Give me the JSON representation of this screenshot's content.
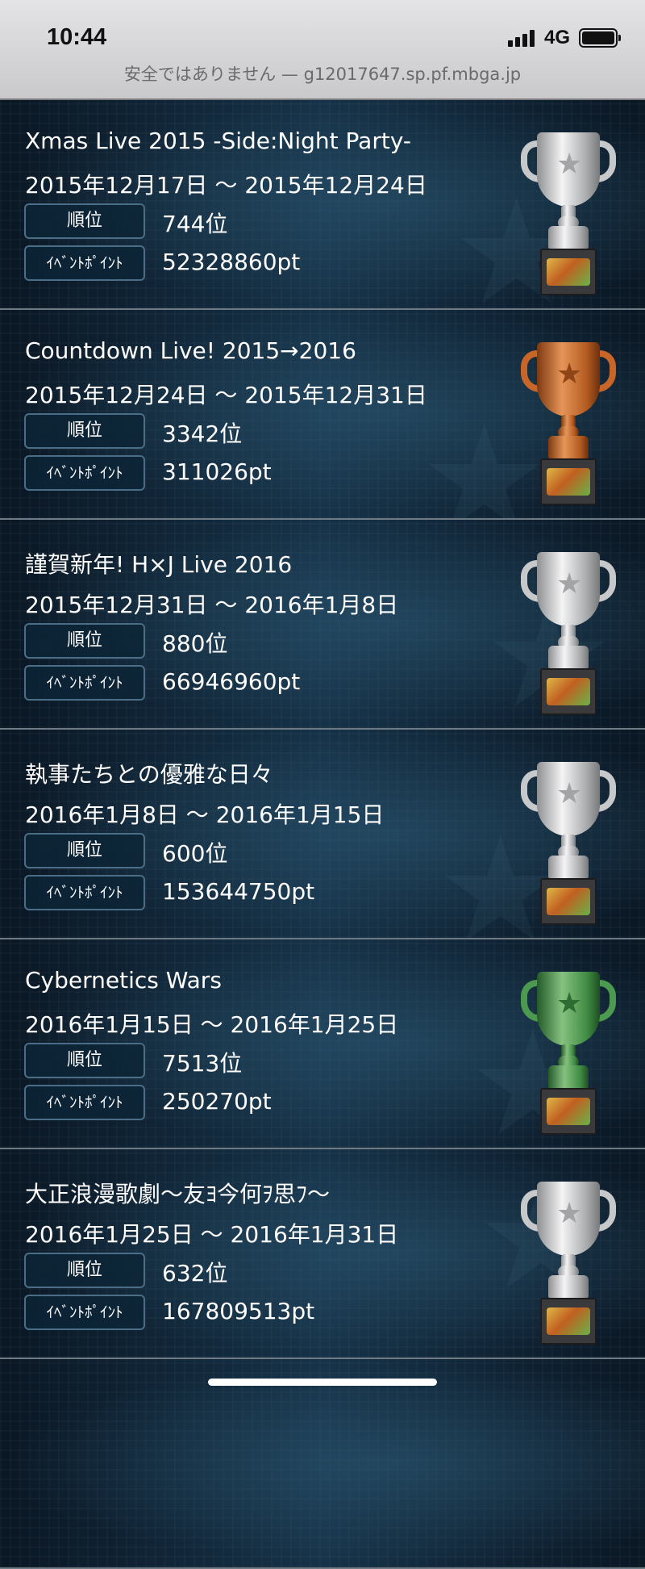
{
  "status_bar": {
    "time": "10:44",
    "network": "4G"
  },
  "url_bar": {
    "text": "安全ではありません — g12017647.sp.pf.mbga.jp"
  },
  "labels": {
    "rank": "順位",
    "points": "ｲﾍﾞﾝﾄﾎﾟｲﾝﾄ"
  },
  "events": [
    {
      "title": "Xmas Live 2015 -Side:Night Party-",
      "period": "2015年12月17日 〜 2015年12月24日",
      "rank": "744位",
      "points": "52328860pt",
      "trophy": "silver"
    },
    {
      "title": "Countdown Live! 2015→2016",
      "period": "2015年12月24日 〜 2015年12月31日",
      "rank": "3342位",
      "points": "311026pt",
      "trophy": "bronze"
    },
    {
      "title": "謹賀新年! H×J Live 2016",
      "period": "2015年12月31日 〜 2016年1月8日",
      "rank": "880位",
      "points": "66946960pt",
      "trophy": "silver"
    },
    {
      "title": "執事たちとの優雅な日々",
      "period": "2016年1月8日 〜 2016年1月15日",
      "rank": "600位",
      "points": "153644750pt",
      "trophy": "silver"
    },
    {
      "title": "Cybernetics Wars",
      "period": "2016年1月15日 〜 2016年1月25日",
      "rank": "7513位",
      "points": "250270pt",
      "trophy": "green"
    },
    {
      "title": "大正浪漫歌劇〜友ﾖ今何ｦ思ﾌ〜",
      "period": "2016年1月25日 〜 2016年1月31日",
      "rank": "632位",
      "points": "167809513pt",
      "trophy": "silver"
    }
  ]
}
